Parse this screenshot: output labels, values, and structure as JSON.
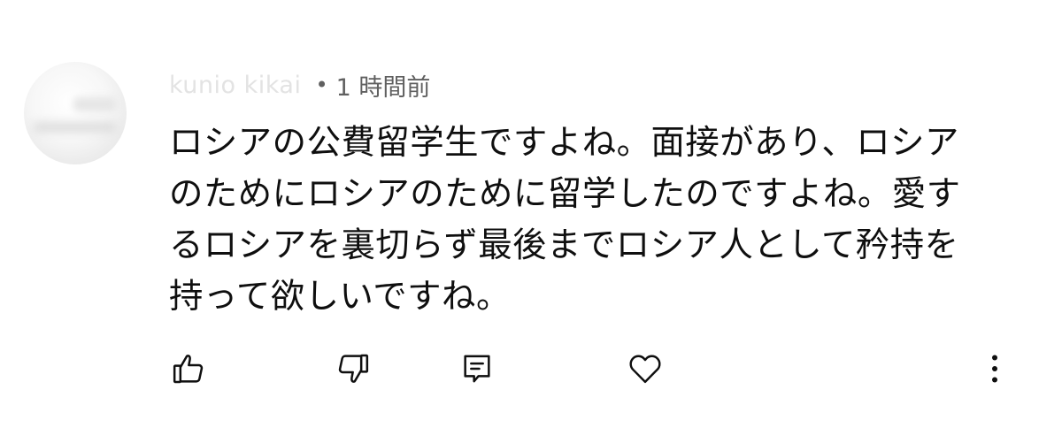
{
  "comment": {
    "author": "kunio kikai",
    "separator": "•",
    "time": "1 時間前",
    "text": "ロシアの公費留学生ですよね。面接があり、ロシアのためにロシアのために留学したのですよね。愛するロシアを裏切らず最後までロシア人として矜持を持って欲しいですね。"
  },
  "actions": {
    "like_icon": "thumbs-up-icon",
    "dislike_icon": "thumbs-down-icon",
    "reply_icon": "comment-icon",
    "heart_icon": "heart-icon",
    "more_icon": "more-vertical-icon"
  },
  "colors": {
    "text": "#0f0f0f",
    "secondary": "#606060",
    "author_faded": "#e3e3e3",
    "background": "#ffffff"
  }
}
